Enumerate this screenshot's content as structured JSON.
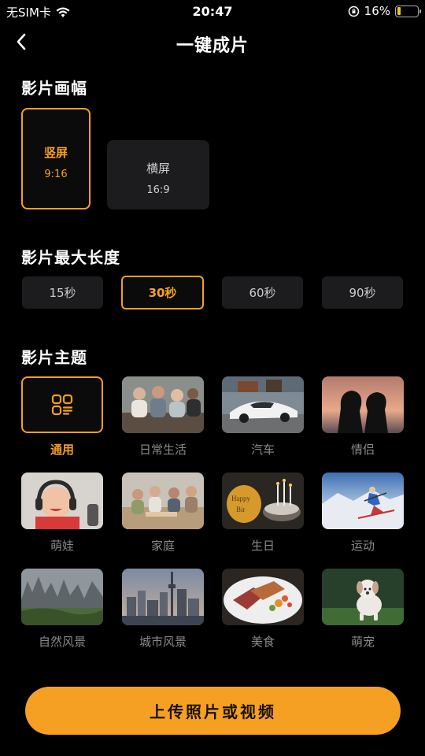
{
  "status": {
    "carrier": "无SIM卡",
    "time": "20:47",
    "battery": "16%",
    "battery_level": 0.16
  },
  "nav": {
    "title": "一键成片"
  },
  "aspect_section": {
    "title": "影片画幅",
    "options": [
      {
        "label": "竖屏",
        "ratio": "9:16",
        "selected": true
      },
      {
        "label": "横屏",
        "ratio": "16:9",
        "selected": false
      }
    ]
  },
  "duration_section": {
    "title": "影片最大长度",
    "options": [
      "15秒",
      "30秒",
      "60秒",
      "90秒"
    ],
    "selected": "30秒"
  },
  "theme_section": {
    "title": "影片主题",
    "themes": [
      {
        "label": "通用",
        "icon": "template-grid-icon",
        "selected": true
      },
      {
        "label": "日常生活"
      },
      {
        "label": "汽车"
      },
      {
        "label": "情侣"
      },
      {
        "label": "萌娃"
      },
      {
        "label": "家庭"
      },
      {
        "label": "生日"
      },
      {
        "label": "运动"
      },
      {
        "label": "自然风景"
      },
      {
        "label": "城市风景"
      },
      {
        "label": "美食"
      },
      {
        "label": "萌宠"
      }
    ]
  },
  "upload_button": {
    "label": "上传照片或视频"
  },
  "colors": {
    "accent": "#f5a023",
    "card": "#1c1c1e",
    "muted": "#8a8a8a"
  }
}
